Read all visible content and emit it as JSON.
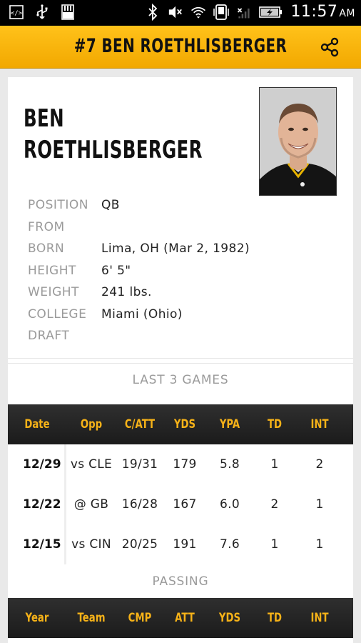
{
  "status_bar": {
    "time": "11:57",
    "ampm": "AM",
    "icons": [
      "debug-icon",
      "usb-icon",
      "sd-card-icon",
      "bluetooth-icon",
      "mute-icon",
      "wifi-icon",
      "vibrate-icon",
      "no-signal-icon",
      "battery-charging-icon"
    ]
  },
  "app_bar": {
    "title": "#7 BEN ROETHLISBERGER",
    "share_icon": "share-icon",
    "accent": "#f6b218"
  },
  "player": {
    "name_line1": "BEN",
    "name_line2": "ROETHLISBERGER",
    "info": [
      {
        "label": "POSITION",
        "value": "QB"
      },
      {
        "label": "FROM",
        "value": ""
      },
      {
        "label": "BORN",
        "value": "Lima, OH (Mar 2, 1982)"
      },
      {
        "label": "HEIGHT",
        "value": "6' 5\""
      },
      {
        "label": "WEIGHT",
        "value": "241 lbs."
      },
      {
        "label": "COLLEGE",
        "value": "Miami (Ohio)"
      },
      {
        "label": "DRAFT",
        "value": ""
      }
    ]
  },
  "last_games": {
    "title": "LAST 3 GAMES",
    "headers": [
      "Date",
      "Opp",
      "C/ATT",
      "YDS",
      "YPA",
      "TD",
      "INT"
    ],
    "rows": [
      {
        "date": "12/29",
        "opp": "vs CLE",
        "catt": "19/31",
        "yds": "179",
        "ypa": "5.8",
        "td": "1",
        "int": "2"
      },
      {
        "date": "12/22",
        "opp": "@ GB",
        "catt": "16/28",
        "yds": "167",
        "ypa": "6.0",
        "td": "2",
        "int": "1"
      },
      {
        "date": "12/15",
        "opp": "vs CIN",
        "catt": "20/25",
        "yds": "191",
        "ypa": "7.6",
        "td": "1",
        "int": "1"
      }
    ]
  },
  "passing": {
    "title": "PASSING",
    "headers": [
      "Year",
      "Team",
      "CMP",
      "ATT",
      "YDS",
      "TD",
      "INT"
    ]
  }
}
